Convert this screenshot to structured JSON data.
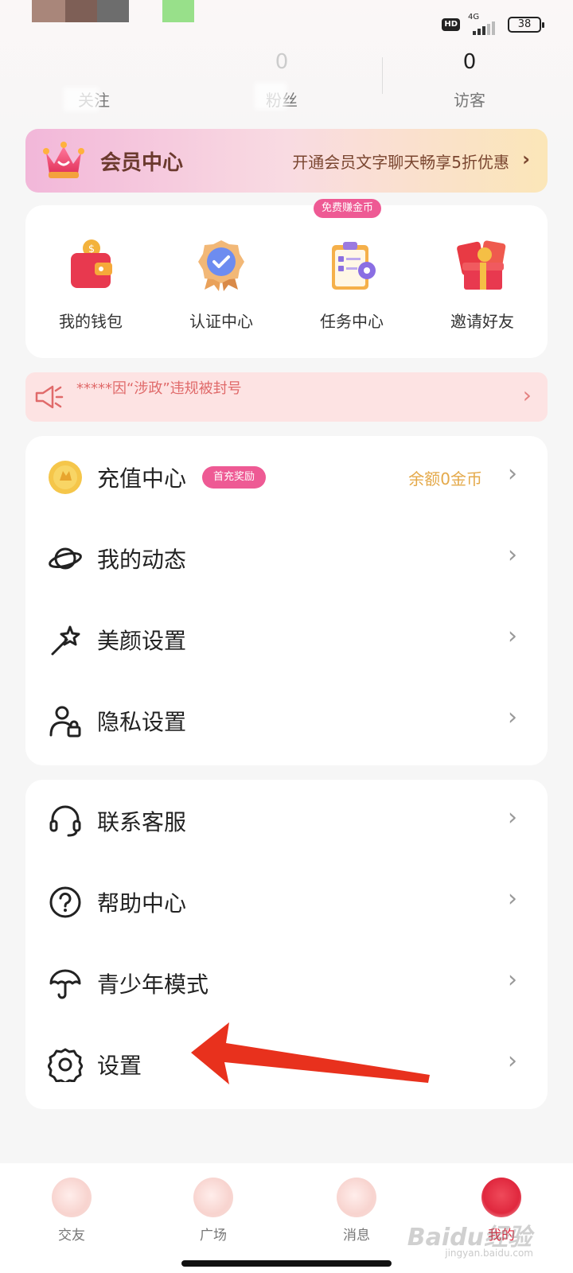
{
  "status_bar": {
    "hd": "HD",
    "network": "4G",
    "battery": "38",
    "masked_colors": [
      "#a9867a",
      "#7e5f56",
      "#6d6d6d",
      "#98e08a"
    ]
  },
  "stats": {
    "items": [
      {
        "count": "",
        "label": "关注"
      },
      {
        "count": "0",
        "label": "粉丝"
      },
      {
        "count": "0",
        "label": "访客"
      }
    ]
  },
  "vip": {
    "icon": "crown-icon",
    "title": "会员中心",
    "promo": "开通会员文字聊天畅享5折优惠",
    "arrow": "›"
  },
  "grid": {
    "free_badge": "免费赚金币",
    "items": [
      {
        "label": "我的钱包",
        "icon": "wallet-icon"
      },
      {
        "label": "认证中心",
        "icon": "verified-badge-icon"
      },
      {
        "label": "任务中心",
        "icon": "task-clipboard-icon"
      },
      {
        "label": "邀请好友",
        "icon": "gift-box-icon"
      }
    ]
  },
  "notice": {
    "icon": "megaphone-icon",
    "text": "*****因“涉政”违规被封号",
    "arrow": "›"
  },
  "menu1": {
    "rows": [
      {
        "label": "充值中心",
        "icon": "gold-coin-icon",
        "badge": "首充奖励",
        "value": "余额0金币",
        "arrow": "›"
      },
      {
        "label": "我的动态",
        "icon": "planet-icon",
        "arrow": "›"
      },
      {
        "label": "美颜设置",
        "icon": "magic-wand-icon",
        "arrow": "›"
      },
      {
        "label": "隐私设置",
        "icon": "user-lock-icon",
        "arrow": "›"
      }
    ]
  },
  "menu2": {
    "rows": [
      {
        "label": "联系客服",
        "icon": "headset-icon",
        "arrow": "›"
      },
      {
        "label": "帮助中心",
        "icon": "help-circle-icon",
        "arrow": "›"
      },
      {
        "label": "青少年模式",
        "icon": "umbrella-icon",
        "arrow": "›"
      },
      {
        "label": "设置",
        "icon": "gear-icon",
        "arrow": "›"
      }
    ]
  },
  "bottom_nav": {
    "tabs": [
      {
        "label": "交友",
        "active": false
      },
      {
        "label": "广场",
        "active": false
      },
      {
        "label": "消息",
        "active": false
      },
      {
        "label": "我的",
        "active": true
      }
    ]
  },
  "watermark": {
    "text": "Baidu经验",
    "url": "jingyan.baidu.com"
  },
  "colors": {
    "accent_pink": "#ee5a94",
    "coin_gold": "#e4a94a",
    "notice_red": "#e06a6a",
    "active_tab": "#e0283e",
    "annotation_arrow": "#e8311d"
  }
}
